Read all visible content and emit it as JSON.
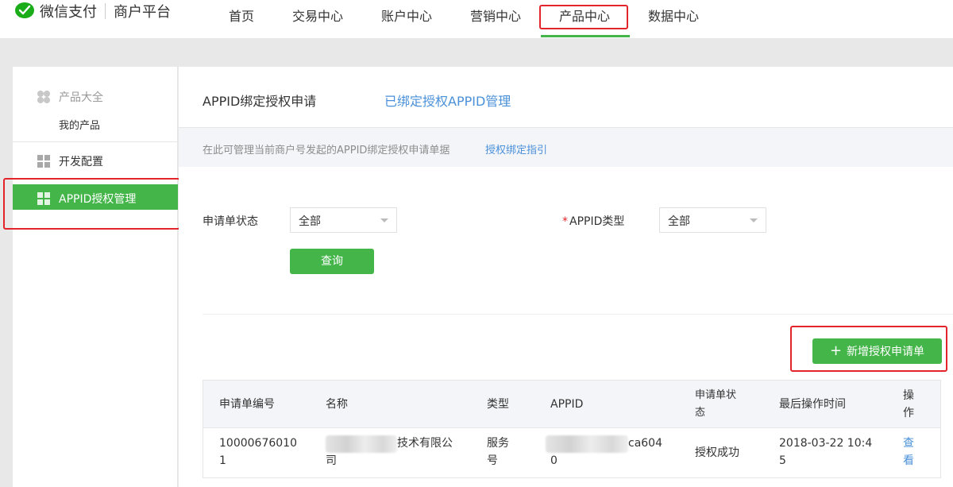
{
  "header": {
    "logo_text": "微信支付",
    "platform": "商户平台",
    "nav": [
      "首页",
      "交易中心",
      "账户中心",
      "营销中心",
      "产品中心",
      "数据中心"
    ],
    "active_nav": "产品中心"
  },
  "sidebar": {
    "group1_title": "产品大全",
    "group1_sub": "我的产品",
    "item_dev": "开发配置",
    "item_active": "APPID授权管理"
  },
  "main": {
    "tab_title": "APPID绑定授权申请",
    "tab_link": "已绑定授权APPID管理",
    "notice_text": "在此可管理当前商户号发起的APPID绑定授权申请单据",
    "notice_link": "授权绑定指引",
    "filter_status_label": "申请单状态",
    "filter_status_value": "全部",
    "filter_type_label": "APPID类型",
    "filter_type_value": "全部",
    "query_button": "查询",
    "new_button": "新增授权申请单"
  },
  "table": {
    "headers": [
      "申请单编号",
      "名称",
      "类型",
      "APPID",
      "申请单状态",
      "最后操作时间",
      "操作"
    ],
    "rows": [
      {
        "id_line1": "10000676010",
        "id_line2": "1",
        "name_line1": "技术有限公",
        "name_line2": "司",
        "type_line1": "服务",
        "type_line2": "号",
        "appid_line1": "ca604",
        "appid_line2": "0",
        "status": "授权成功",
        "time_line1": "2018-03-22 10:4",
        "time_line2": "5",
        "op_line1": "查",
        "op_line2": "看"
      }
    ]
  },
  "colors": {
    "brand": "#44b549",
    "link": "#4a90d9",
    "highlight": "#e3242b"
  }
}
